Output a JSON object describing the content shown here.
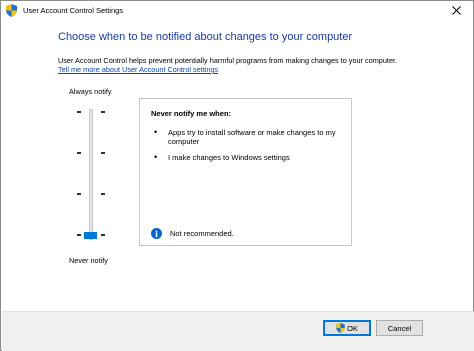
{
  "window": {
    "title": "User Account Control Settings"
  },
  "heading": "Choose when to be notified about changes to your computer",
  "description": "User Account Control helps prevent potentially harmful programs from making changes to your computer.",
  "help_link": "Tell me more about User Account Control settings",
  "slider": {
    "top_label": "Always notify",
    "bottom_label": "Never notify",
    "levels": 4,
    "selected_level": 1
  },
  "info": {
    "title": "Never notify me when:",
    "bullets": [
      "Apps try to install software or make changes to my computer",
      "I make changes to Windows settings"
    ],
    "note": "Not recommended."
  },
  "buttons": {
    "ok": "OK",
    "cancel": "Cancel"
  },
  "icons": {
    "title": "uac-shield-icon",
    "close": "close-icon",
    "info": "info-icon",
    "ok_shield": "uac-shield-icon"
  },
  "colors": {
    "heading": "#1c3a9e",
    "link": "#0645ad",
    "accent": "#0078d7",
    "info": "#0a64c8"
  }
}
